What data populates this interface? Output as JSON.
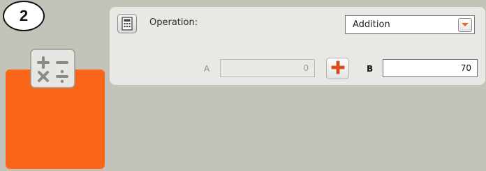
{
  "step": {
    "number": "2"
  },
  "block": {
    "icon": "math-operators-icon",
    "color": "#fb6519"
  },
  "panel": {
    "config_icon": "calculator-icon",
    "operation_label": "Operation:",
    "operation_value": "Addition",
    "input_a": {
      "label": "A",
      "value": "0",
      "enabled": false
    },
    "operator_button": "plus-icon",
    "input_b": {
      "label": "B",
      "value": "70",
      "enabled": true
    }
  }
}
